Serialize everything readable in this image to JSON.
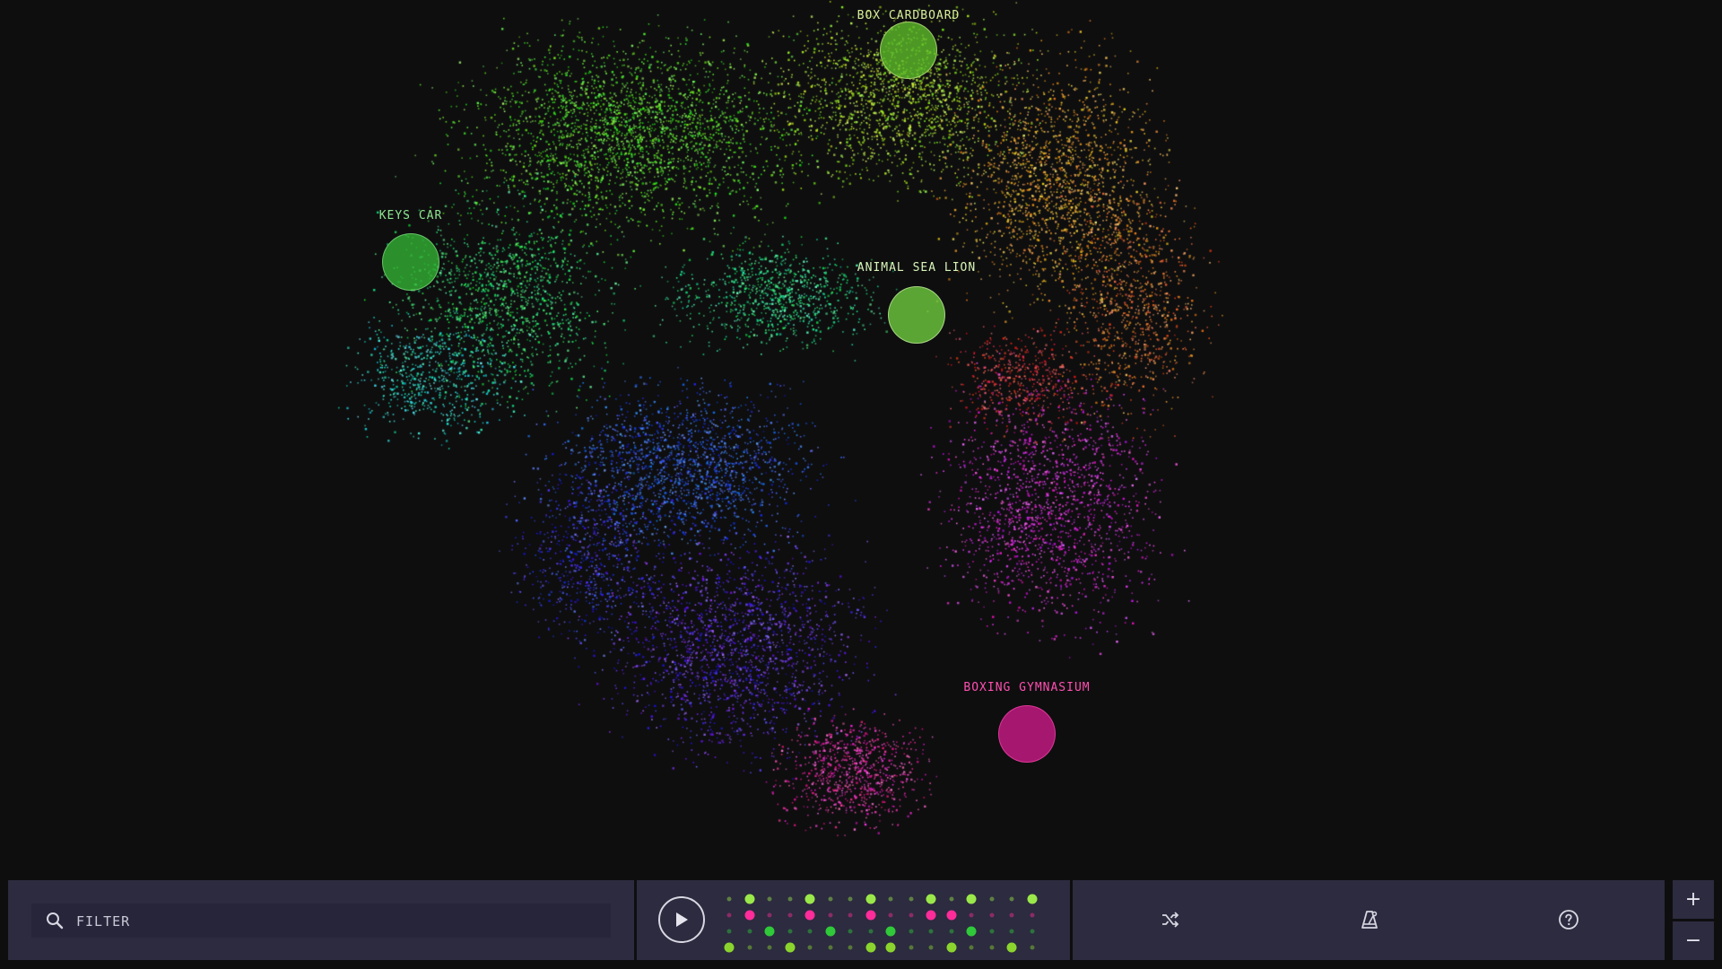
{
  "markers": [
    {
      "label": "BOX CARDBOARD",
      "color": "#5fbf2a",
      "label_color": "#d9ef9a"
    },
    {
      "label": "KEYS CAR",
      "color": "#33b533",
      "label_color": "#8fe58f"
    },
    {
      "label": "ANIMAL SEA LION",
      "color": "#6fcf3f",
      "label_color": "#d9f5b8"
    },
    {
      "label": "BOXING GYMNASIUM",
      "color": "#d11a8a",
      "label_color": "#ff4fb0"
    }
  ],
  "filter": {
    "placeholder": "FILTER",
    "value": "",
    "icon": "search-icon"
  },
  "player": {
    "play_icon": "play-icon",
    "sequencer": {
      "rows": [
        {
          "color": "#9be84a",
          "active": [
            1,
            4,
            7,
            10,
            12,
            15
          ]
        },
        {
          "color": "#ff2c9a",
          "active": [
            1,
            4,
            7,
            10,
            11
          ]
        },
        {
          "color": "#2fc93a",
          "active": [
            2,
            5,
            8,
            12
          ]
        },
        {
          "color": "#8bd42e",
          "active": [
            0,
            3,
            7,
            8,
            11,
            14
          ]
        }
      ],
      "steps": 16
    }
  },
  "tools": [
    {
      "name": "shuffle",
      "icon": "shuffle-icon"
    },
    {
      "name": "metronome",
      "icon": "metronome-icon"
    },
    {
      "name": "help",
      "icon": "help-icon"
    }
  ],
  "zoom": {
    "in_label": "+",
    "out_label": "−"
  },
  "colors": {
    "background": "#0e0e0f",
    "panel": "#2c2b3f",
    "panel_inner": "#26253a"
  }
}
